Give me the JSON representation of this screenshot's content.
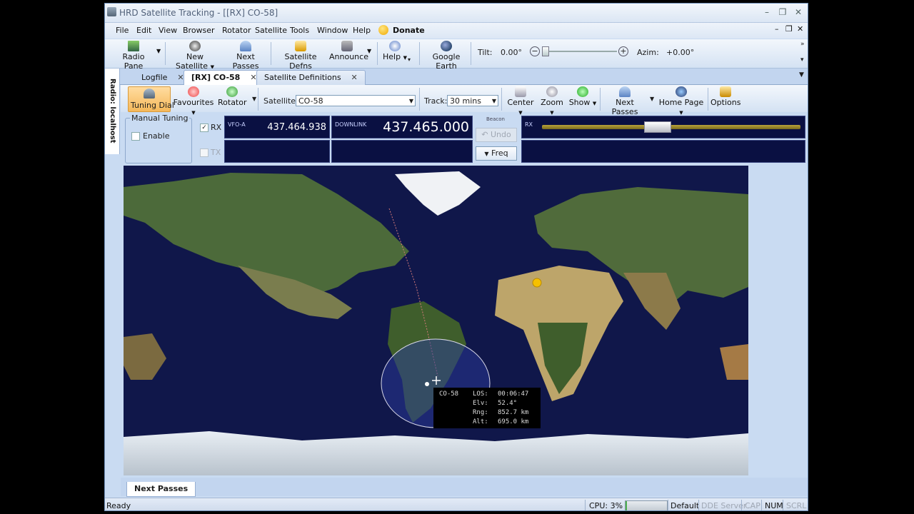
{
  "window": {
    "title": "HRD Satellite Tracking - [[RX]  CO-58]"
  },
  "menubar": {
    "items": [
      "File",
      "Edit",
      "View",
      "Browser",
      "Rotator",
      "Satellite",
      "Tools",
      "Window",
      "Help"
    ],
    "donate": "Donate"
  },
  "toolbar1": {
    "radio_pane": "Radio Pane",
    "new_satellite": "New Satellite",
    "next_passes": "Next Passes",
    "satellite_defns": "Satellite Defns",
    "announce": "Announce",
    "help": "Help",
    "google_earth": "Google Earth",
    "tilt_label": "Tilt:",
    "tilt_value": "0.00°",
    "azim_label": "Azim:",
    "azim_value": "+0.00°"
  },
  "side_strip": {
    "label": "Radio: localhost"
  },
  "tabs": [
    {
      "label": "Logfile"
    },
    {
      "label": "[RX]  CO-58",
      "active": true
    },
    {
      "label": "Satellite Definitions"
    }
  ],
  "toolbar2": {
    "tuning_dial": "Tuning Dial",
    "favourites": "Favourites",
    "rotator": "Rotator",
    "satellite_label": "Satellite:",
    "satellite_value": "CO-58",
    "track_label": "Track:",
    "track_value": "30 mins",
    "center": "Center",
    "zoom": "Zoom",
    "show": "Show",
    "next_passes": "Next Passes",
    "home_page": "Home Page",
    "options": "Options"
  },
  "radio_panel": {
    "manual_tuning": "Manual Tuning",
    "enable": "Enable",
    "rx": "RX",
    "tx": "TX",
    "vfo_label": "VFO-A",
    "vfo_value": "437.464.938",
    "downlink_label": "DOWNLINK",
    "downlink_value": "437.465.000",
    "beacon": "Beacon",
    "undo": "Undo",
    "freq": "Freq",
    "rx_meter_label": "RX",
    "rx_meter_level": 0.44
  },
  "map": {
    "tooltip": {
      "sat": "CO-58",
      "los_label": "LOS:",
      "los": "00:06:47",
      "elv_label": "Elv:",
      "elv": "52.4°",
      "rng_label": "Rng:",
      "rng": "852.7 km",
      "alt_label": "Alt:",
      "alt": "695.0 km"
    }
  },
  "bottom_tab": "Next Passes",
  "statusbar": {
    "ready": "Ready",
    "cpu": "CPU: 3%",
    "theme": "Default",
    "dde": "DDE Server",
    "cap": "CAP",
    "num": "NUM",
    "scrl": "SCRL"
  },
  "colors": {
    "chrome": "#c9dbf2",
    "lcd_bg": "#0a1042",
    "ocean": "#10174a",
    "accent": "#f7c873"
  }
}
